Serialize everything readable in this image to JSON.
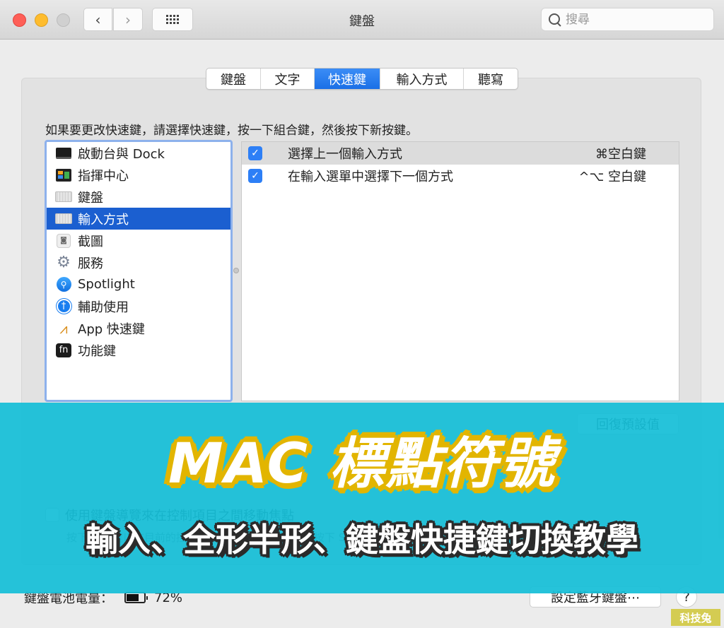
{
  "window": {
    "title": "鍵盤",
    "search_placeholder": "搜尋",
    "nav": {
      "back": "‹",
      "forward": "›"
    }
  },
  "tabs": [
    {
      "label": "鍵盤",
      "active": false
    },
    {
      "label": "文字",
      "active": false
    },
    {
      "label": "快速鍵",
      "active": true
    },
    {
      "label": "輸入方式",
      "active": false
    },
    {
      "label": "聽寫",
      "active": false
    }
  ],
  "instruction": "如果要更改快速鍵，請選擇快速鍵，按一下組合鍵，然後按下新按鍵。",
  "categories": [
    {
      "label": "啟動台與 Dock",
      "icon": "dock-icon"
    },
    {
      "label": "指揮中心",
      "icon": "mission-control-icon"
    },
    {
      "label": "鍵盤",
      "icon": "keyboard-icon"
    },
    {
      "label": "輸入方式",
      "icon": "keyboard-icon",
      "selected": true
    },
    {
      "label": "截圖",
      "icon": "screenshot-icon"
    },
    {
      "label": "服務",
      "icon": "gear-icon"
    },
    {
      "label": "Spotlight",
      "icon": "spotlight-icon"
    },
    {
      "label": "輔助使用",
      "icon": "accessibility-icon"
    },
    {
      "label": "App 快速鍵",
      "icon": "app-store-icon"
    },
    {
      "label": "功能鍵",
      "icon": "fn-icon"
    }
  ],
  "icon_glyphs": {
    "screenshot": "◙",
    "gear": "⚙",
    "spotlight": "⚲",
    "accessibility": "♿",
    "app": "⩘",
    "fn": "fn"
  },
  "shortcuts": [
    {
      "checked": true,
      "label": "選擇上一個輸入方式",
      "key": "⌘空白鍵",
      "selected": true
    },
    {
      "checked": true,
      "label": "在輸入選單中選擇下一個方式",
      "key": "^⌥ 空白鍵",
      "selected": false
    }
  ],
  "checkmark": "✓",
  "restore_defaults": "回復預設值",
  "keyboard_navigation": {
    "label": "使用鍵盤導覽來在控制項目之間移動焦點",
    "hint": "按下 Tab 鍵以在目前的控制項目之間移動鍵盤焦點，按下 Shift Tab 鍵則往反方向移動。",
    "checked": false
  },
  "battery": {
    "label": "鍵盤電池電量：",
    "value": "72%",
    "level": 0.72
  },
  "bluetooth_button": "設定藍牙鍵盤⋯",
  "help_button": "?",
  "banner": {
    "title": "MAC 標點符號",
    "subtitle": "輸入、全形半形、鍵盤快捷鍵切換教學"
  },
  "watermark": "科技兔",
  "colors": {
    "accent": "#1b5fd0",
    "tab_active": "#2a7ef2",
    "banner": "#15bed7",
    "title_outline": "#e2b500",
    "watermark": "#d4cc52"
  }
}
